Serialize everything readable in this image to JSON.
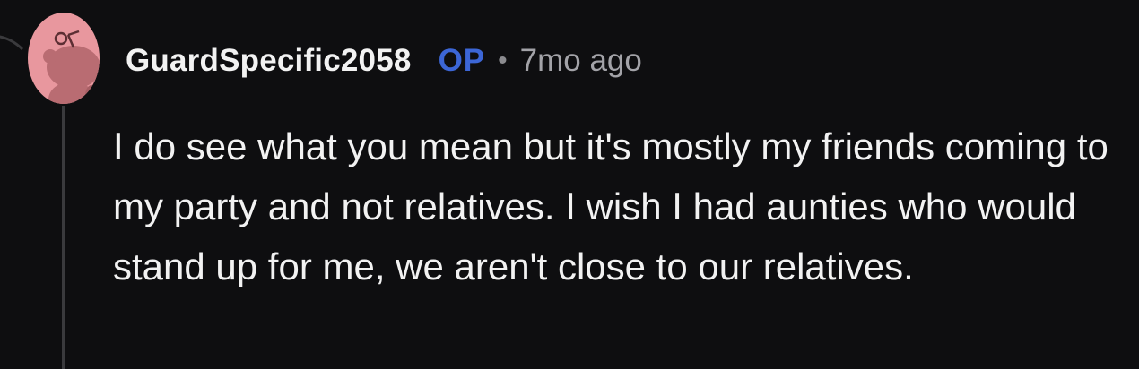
{
  "comment": {
    "author": "GuardSpecific2058",
    "op_badge": "OP",
    "separator": "•",
    "timestamp": "7mo ago",
    "avatar_icon": "snoo-avatar-icon",
    "body": "I do see what you mean but it's mostly my friends coming to my party and not relatives. I wish I had aunties who would stand up for me, we aren't close to our relatives."
  },
  "colors": {
    "background": "#0e0e10",
    "text": "#f2f2f2",
    "op_accent": "#3c66d6",
    "muted": "#a3a3a8",
    "avatar_bg": "#e8979e",
    "thread_line": "#3a3a3d"
  }
}
